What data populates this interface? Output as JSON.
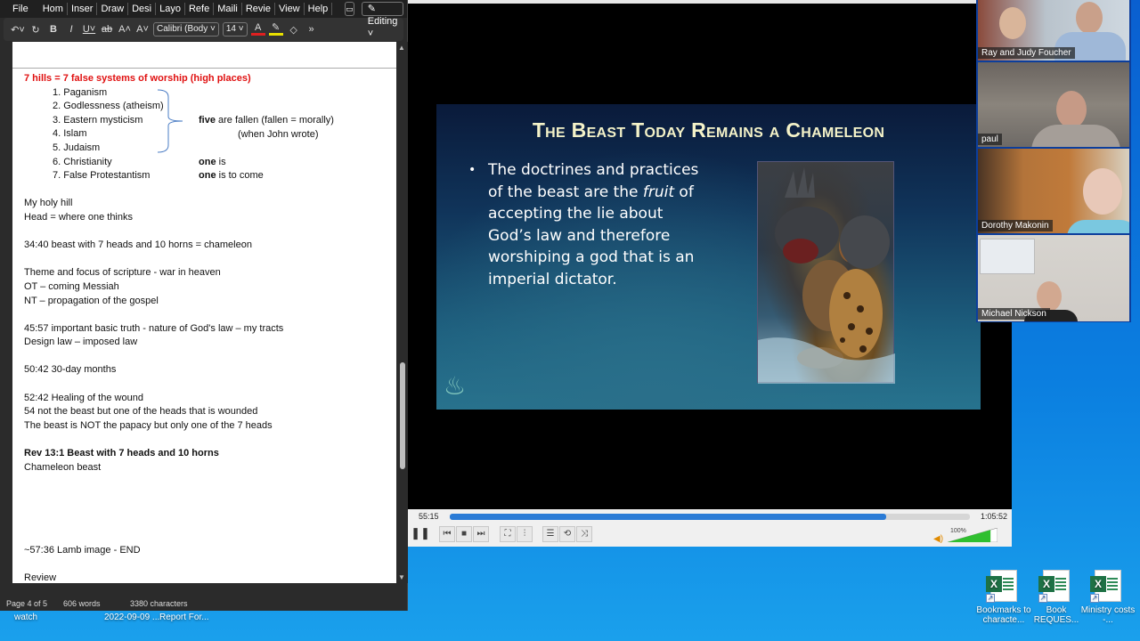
{
  "word": {
    "menu": [
      "File",
      "Hom",
      "Inser",
      "Draw",
      "Desi",
      "Layo",
      "Refe",
      "Maili",
      "Revie",
      "View",
      "Help"
    ],
    "comment_icon": "comment-icon",
    "editing_label": "✎ Editing ˅",
    "toolbar": {
      "undo": "↶˅",
      "redo": "↻",
      "bold": "B",
      "italic": "I",
      "underline": "U˅",
      "strike": "ab",
      "grow": "A˄",
      "shrink": "A˅",
      "font_name": "Calibri (Body ˅",
      "font_size": "14   ˅",
      "font_color": "A",
      "highlight": "✎",
      "shading": "◇",
      "more": "»"
    },
    "doc": {
      "heading": "7 hills = 7 false systems of worship (high places)",
      "list": [
        "1. Paganism",
        "2. Godlessness (atheism)",
        "3. Eastern mysticism",
        "4. Islam",
        "5. Judaism",
        "6. Christianity",
        "7. False Protestantism"
      ],
      "note_five_bold": "five",
      "note_five_rest": " are fallen (fallen = morally)",
      "note_john": "(when John wrote)",
      "note_one_bold": "one",
      "note_one_is": " is",
      "note_one_come": " is to come",
      "lines_a": [
        "My holy hill",
        "Head = where one thinks"
      ],
      "line_b": "34:40 beast with 7 heads and 10 horns = chameleon",
      "lines_c": [
        "Theme and focus of scripture - war in heaven",
        "OT – coming Messiah",
        "NT – propagation of the gospel"
      ],
      "lines_d": [
        "45:57 important basic truth - nature of God's law – my tracts",
        "Design law – imposed law"
      ],
      "line_e": "50:42 30-day months",
      "lines_f": [
        "52:42 Healing of the wound",
        "54 not the beast but one of the heads that is wounded",
        "The beast is NOT the papacy but only one of the 7 heads"
      ],
      "bold_line": "Rev 13:1 Beast with 7 heads and 10 horns",
      "line_g": "Chameleon beast",
      "line_h": "~57:36 Lamb image - END",
      "line_i": "Review"
    },
    "status": {
      "page": "Page 4 of 5",
      "words": "606 words",
      "chars": "3380 characters"
    }
  },
  "vlc": {
    "slide": {
      "title": "The Beast Today Remains a Chameleon",
      "bullet_pre": "The doctrines and practices of the beast are the ",
      "bullet_em": "fruit",
      "bullet_post": " of accepting the lie about God’s law and therefore worshiping a god that is an imperial dictator."
    },
    "elapsed": "55:15",
    "total": "1:05:52",
    "progress": 0.839,
    "volume_label": "100%",
    "volume": 1.0,
    "buttons": {
      "pause": "❚❚",
      "prev": "⏮",
      "stop": "■",
      "next": "⏭",
      "fullscreen": "⛶",
      "ext": "⫶",
      "playlist": "☰",
      "loop": "⟲",
      "shuffle": "⤨"
    }
  },
  "zoom": {
    "participants": [
      "Ray and Judy Foucher",
      "paul",
      "Dorothy Makonin",
      "Michael Nickson"
    ]
  },
  "desktop": {
    "behind_labels": [
      "watch",
      "2022-09-09 ...",
      "Report For..."
    ],
    "icons": [
      {
        "label": "Bookmarks to characte...",
        "type": "excel"
      },
      {
        "label": "Book REQUES...",
        "type": "excel"
      },
      {
        "label": "Ministry costs -...",
        "type": "excel"
      }
    ]
  }
}
